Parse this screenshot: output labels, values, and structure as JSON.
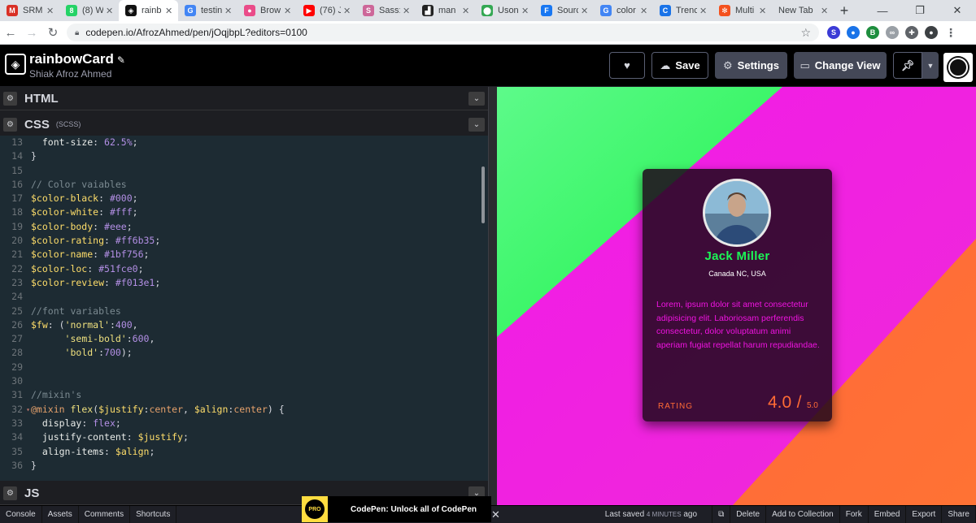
{
  "browser": {
    "tabs": [
      {
        "label": "SRM",
        "icon": "gmail-icon",
        "color": "#d93025",
        "glyph": "M"
      },
      {
        "label": "(8) W",
        "icon": "whatsapp-icon",
        "color": "#25d366",
        "glyph": "8"
      },
      {
        "label": "rainb",
        "icon": "codepen-icon",
        "color": "#111111",
        "glyph": "◈",
        "active": true
      },
      {
        "label": "testin",
        "icon": "google-icon",
        "color": "#4285f4",
        "glyph": "G"
      },
      {
        "label": "Brow",
        "icon": "dribbble-icon",
        "color": "#ea4c89",
        "glyph": "●"
      },
      {
        "label": "(76) J",
        "icon": "youtube-icon",
        "color": "#ff0000",
        "glyph": "▶"
      },
      {
        "label": "Sass:",
        "icon": "sass-icon",
        "color": "#cd6799",
        "glyph": "S"
      },
      {
        "label": "man",
        "icon": "document-icon",
        "color": "#222222",
        "glyph": "▟"
      },
      {
        "label": "Uson",
        "icon": "maps-icon",
        "color": "#34a853",
        "glyph": "⬤"
      },
      {
        "label": "Sourc",
        "icon": "facebook-icon",
        "color": "#1877f2",
        "glyph": "F"
      },
      {
        "label": "color",
        "icon": "google-icon",
        "color": "#4285f4",
        "glyph": "G"
      },
      {
        "label": "Trenc",
        "icon": "trending-icon",
        "color": "#1a73e8",
        "glyph": "C"
      },
      {
        "label": "Multi",
        "icon": "multicolor-icon",
        "color": "#f4511e",
        "glyph": "✻"
      },
      {
        "label": "New Tab",
        "icon": "",
        "color": "transparent",
        "glyph": ""
      }
    ],
    "url": "codepen.io/AfrozAhmed/pen/jOqjbpL?editors=0100"
  },
  "header": {
    "title": "rainbowCard",
    "author": "Shiak Afroz Ahmed",
    "save_label": "Save",
    "settings_label": "Settings",
    "change_view_label": "Change View"
  },
  "editor": {
    "html_label": "HTML",
    "css_label": "CSS",
    "css_sub": "(SCSS)",
    "js_label": "JS",
    "code_lines": [
      {
        "n": "13",
        "tokens": [
          [
            "  ",
            "pn"
          ],
          [
            "font-size",
            "prop"
          ],
          [
            ": ",
            "pn"
          ],
          [
            "62.5%",
            "num"
          ],
          [
            ";",
            "pn"
          ]
        ]
      },
      {
        "n": "14",
        "tokens": [
          [
            "}",
            "pn"
          ]
        ]
      },
      {
        "n": "15",
        "tokens": []
      },
      {
        "n": "16",
        "tokens": [
          [
            "// Color vaiables",
            "com"
          ]
        ]
      },
      {
        "n": "17",
        "tokens": [
          [
            "$color-black",
            "var"
          ],
          [
            ": ",
            "pn"
          ],
          [
            "#000",
            "num"
          ],
          [
            ";",
            "pn"
          ]
        ]
      },
      {
        "n": "18",
        "tokens": [
          [
            "$color-white",
            "var"
          ],
          [
            ": ",
            "pn"
          ],
          [
            "#fff",
            "num"
          ],
          [
            ";",
            "pn"
          ]
        ]
      },
      {
        "n": "19",
        "tokens": [
          [
            "$color-body",
            "var"
          ],
          [
            ": ",
            "pn"
          ],
          [
            "#eee",
            "num"
          ],
          [
            ";",
            "pn"
          ]
        ]
      },
      {
        "n": "20",
        "tokens": [
          [
            "$color-rating",
            "var"
          ],
          [
            ": ",
            "pn"
          ],
          [
            "#ff6b35",
            "num"
          ],
          [
            ";",
            "pn"
          ]
        ]
      },
      {
        "n": "21",
        "tokens": [
          [
            "$color-name",
            "var"
          ],
          [
            ": ",
            "pn"
          ],
          [
            "#1bf756",
            "num"
          ],
          [
            ";",
            "pn"
          ]
        ]
      },
      {
        "n": "22",
        "tokens": [
          [
            "$color-loc",
            "var"
          ],
          [
            ": ",
            "pn"
          ],
          [
            "#51fce0",
            "num"
          ],
          [
            ";",
            "pn"
          ]
        ]
      },
      {
        "n": "23",
        "tokens": [
          [
            "$color-review",
            "var"
          ],
          [
            ": ",
            "pn"
          ],
          [
            "#f013e1",
            "num"
          ],
          [
            ";",
            "pn"
          ]
        ]
      },
      {
        "n": "24",
        "tokens": []
      },
      {
        "n": "25",
        "tokens": [
          [
            "//font variables",
            "com"
          ]
        ]
      },
      {
        "n": "26",
        "tokens": [
          [
            "$fw",
            "var"
          ],
          [
            ": (",
            "pn"
          ],
          [
            "'normal'",
            "str"
          ],
          [
            ":",
            "pn"
          ],
          [
            "400",
            "num"
          ],
          [
            ",",
            "pn"
          ]
        ]
      },
      {
        "n": "27",
        "tokens": [
          [
            "      ",
            "pn"
          ],
          [
            "'semi-bold'",
            "str"
          ],
          [
            ":",
            "pn"
          ],
          [
            "600",
            "num"
          ],
          [
            ",",
            "pn"
          ]
        ]
      },
      {
        "n": "28",
        "tokens": [
          [
            "      ",
            "pn"
          ],
          [
            "'bold'",
            "str"
          ],
          [
            ":",
            "pn"
          ],
          [
            "700",
            "num"
          ],
          [
            ");",
            "pn"
          ]
        ]
      },
      {
        "n": "29",
        "tokens": []
      },
      {
        "n": "30",
        "tokens": []
      },
      {
        "n": "31",
        "tokens": [
          [
            "//mixin's",
            "com"
          ]
        ]
      },
      {
        "n": "32",
        "fold": true,
        "tokens": [
          [
            "@mixin",
            "kw"
          ],
          [
            " ",
            "pn"
          ],
          [
            "flex",
            "fn"
          ],
          [
            "(",
            "pn"
          ],
          [
            "$justify",
            "var"
          ],
          [
            ":",
            "pn"
          ],
          [
            "center",
            "kw"
          ],
          [
            ", ",
            "pn"
          ],
          [
            "$align",
            "var"
          ],
          [
            ":",
            "pn"
          ],
          [
            "center",
            "kw"
          ],
          [
            ") {",
            "pn"
          ]
        ]
      },
      {
        "n": "33",
        "tokens": [
          [
            "  ",
            "pn"
          ],
          [
            "display",
            "prop"
          ],
          [
            ": ",
            "pn"
          ],
          [
            "flex",
            "num"
          ],
          [
            ";",
            "pn"
          ]
        ]
      },
      {
        "n": "34",
        "tokens": [
          [
            "  ",
            "pn"
          ],
          [
            "justify-content",
            "prop"
          ],
          [
            ": ",
            "pn"
          ],
          [
            "$justify",
            "var"
          ],
          [
            ";",
            "pn"
          ]
        ]
      },
      {
        "n": "35",
        "tokens": [
          [
            "  ",
            "pn"
          ],
          [
            "align-items",
            "prop"
          ],
          [
            ": ",
            "pn"
          ],
          [
            "$align",
            "var"
          ],
          [
            ";",
            "pn"
          ]
        ]
      },
      {
        "n": "36",
        "tokens": [
          [
            "}",
            "pn"
          ]
        ]
      }
    ]
  },
  "card": {
    "name": "Jack Miller",
    "location": "Canada NC, USA",
    "review": "Lorem, ipsum dolor sit amet consectetur adipisicing elit. Laboriosam perferendis consectetur, dolor voluptatum animi aperiam fugiat repellat harum repudiandae.",
    "rating_label": "RATING",
    "rating_value": "4.0",
    "rating_slash": "/",
    "rating_max": "5.0",
    "colors": {
      "name": "#1bf756",
      "review": "#f013e1",
      "rating": "#ff6b35"
    }
  },
  "footer": {
    "buttons": [
      "Console",
      "Assets",
      "Comments",
      "Shortcuts"
    ],
    "promo_badge": "PRO",
    "promo_text": "CodePen: Unlock all of CodePen",
    "last_saved": "Last saved",
    "saved_ago": "4 MINUTES",
    "saved_suffix": "ago",
    "right_buttons": [
      "Delete",
      "Add to Collection",
      "Fork",
      "Embed",
      "Export",
      "Share"
    ]
  }
}
